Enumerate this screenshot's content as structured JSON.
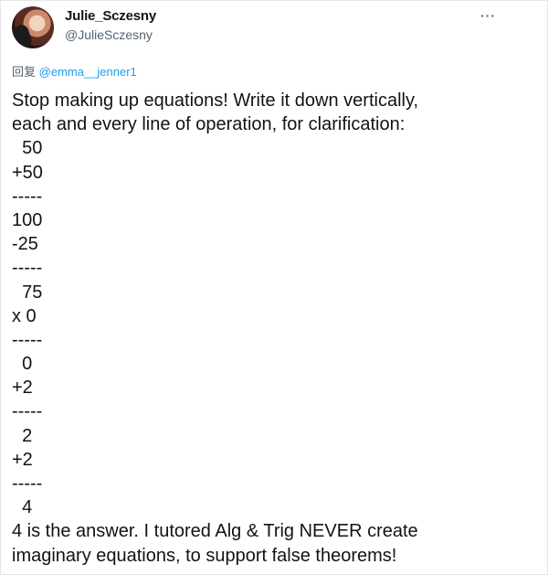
{
  "tweet": {
    "display_name": "Julie_Sczesny",
    "handle": "@JulieSczesny",
    "more_label": "···",
    "reply_prefix": "回复",
    "reply_mention": "@emma__jenner1",
    "lines": [
      "Stop making up equations! Write it down vertically,",
      "each and every line of operation, for clarification:",
      "  50",
      "+50",
      "-----",
      "100",
      "-25",
      "-----",
      "  75",
      "x 0",
      "-----",
      "  0",
      "+2",
      "-----",
      "  2",
      "+2",
      "-----",
      "  4",
      "4 is the answer. I tutored Alg & Trig NEVER create",
      "imaginary equations, to support false theorems!"
    ]
  }
}
